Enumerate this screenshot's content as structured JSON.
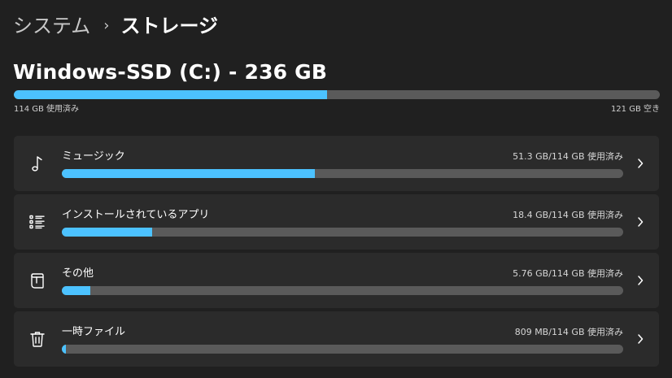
{
  "breadcrumb": {
    "parent": "システム",
    "separator": "›",
    "current": "ストレージ"
  },
  "drive": {
    "title": "Windows-SSD (C:) - 236 GB",
    "used_label": "114 GB 使用済み",
    "free_label": "121 GB 空き",
    "used_fraction": 0.485,
    "bar_color": "#4cc2ff"
  },
  "categories": [
    {
      "label": "ミュージック",
      "size": "51.3 GB/114 GB 使用済み",
      "fraction": 0.45,
      "icon": "music-note-icon"
    },
    {
      "label": "インストールされているアプリ",
      "size": "18.4 GB/114 GB 使用済み",
      "fraction": 0.161,
      "icon": "apps-list-icon"
    },
    {
      "label": "その他",
      "size": "5.76 GB/114 GB 使用済み",
      "fraction": 0.051,
      "icon": "other-files-icon"
    },
    {
      "label": "一時ファイル",
      "size": "809 MB/114 GB 使用済み",
      "fraction": 0.007,
      "icon": "trash-icon"
    }
  ]
}
